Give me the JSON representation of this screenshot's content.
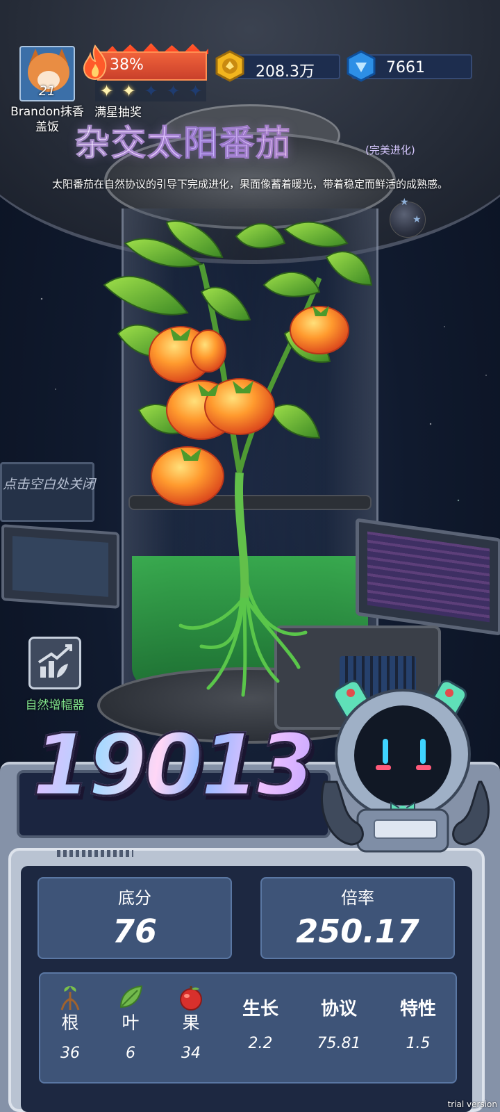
{
  "player": {
    "name": "Brandon抹香盖饭",
    "level": "21"
  },
  "fire": {
    "percent": "38%",
    "fill": 0.38
  },
  "stars": {
    "lit": 2,
    "total": 5,
    "label": "满星抽奖"
  },
  "resources": {
    "gold": "208.3万",
    "gems": "7661"
  },
  "plant": {
    "title": "杂交太阳番茄",
    "tag": "(完美进化)",
    "description": "太阳番茄在自然协议的引导下完成进化，果面像蓄着暖光，带着稳定而鲜活的成熟感。"
  },
  "hints": {
    "close": "点击空白处关闭"
  },
  "booster": {
    "label": "自然增幅器"
  },
  "score": {
    "total": "19013",
    "base_label": "底分",
    "base_value": "76",
    "mult_label": "倍率",
    "mult_value": "250.17"
  },
  "stats": [
    {
      "name": "根",
      "value": "36",
      "icon": "root-icon"
    },
    {
      "name": "叶",
      "value": "6",
      "icon": "leaf-icon"
    },
    {
      "name": "果",
      "value": "34",
      "icon": "fruit-icon"
    },
    {
      "name": "生长",
      "value": "2.2"
    },
    {
      "name": "协议",
      "value": "75.81"
    },
    {
      "name": "特性",
      "value": "1.5"
    }
  ],
  "watermark": "trial version",
  "colors": {
    "title_gradient": "#f1d6ff",
    "booster_label": "#7fe08a",
    "fire": "#e5533a",
    "card": "#3e5478"
  }
}
